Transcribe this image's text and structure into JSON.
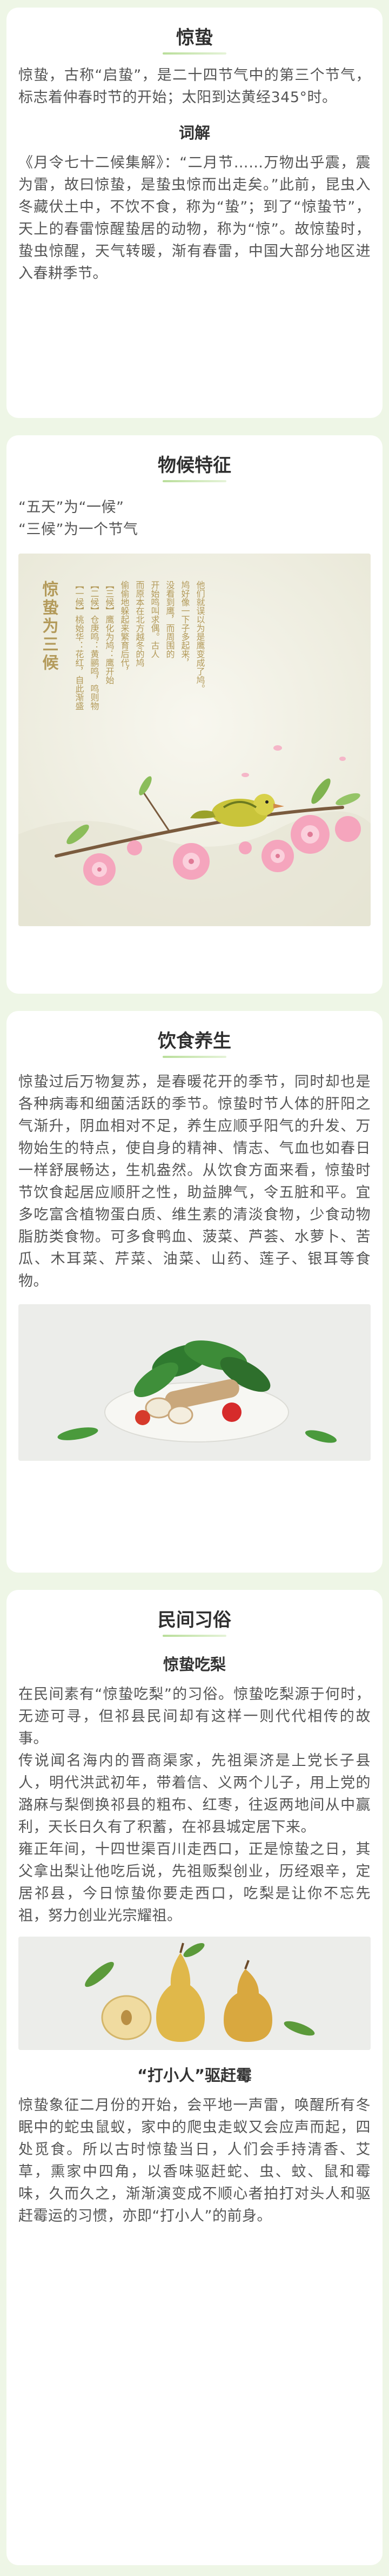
{
  "sections": {
    "jingzhe": {
      "title": "惊蛰",
      "para1": "惊蛰，古称“启蛰”，是二十四节气中的第三个节气，标志着仲春时节的开始；太阳到达黄经345°时。",
      "sub": "词解",
      "para2": "《月令七十二候集解》：“二月节……万物出乎震，震为雷，故曰惊蛰，是蛰虫惊而出走矣。”此前，昆虫入冬藏伏土中，不饮不食，称为“蛰”；到了“惊蛰节”，天上的春雷惊醒蛰居的动物，称为“惊”。故惊蛰时，蛰虫惊醒，天气转暖，渐有春雷，中国大部分地区进入春耕季节。"
    },
    "climate": {
      "title": "物候特征",
      "line1": "“五天”为“一候”",
      "line2": "“三候”为一个节气",
      "art_title": "惊蛰为三候",
      "art_col1": "【一候】桃始华：花红，自此渐盛",
      "art_col2": "【二候】仓庚鸣：黄鹂鸣，鸣则物",
      "art_col3": "【三候】鹰化为鸠：鹰开始",
      "art_col4": "偷偷地躲起来繁育后代，",
      "art_col5": "而原本在北方越冬的鸠",
      "art_col6": "开始鸣叫求偶。古人",
      "art_col7": "没看到鹰，而周围的",
      "art_col8": "鸠好像一下子多起来，",
      "art_col9": "他们就误以为是鹰变成了鸠。"
    },
    "diet": {
      "title": "饮食养生",
      "para": "惊蛰过后万物复苏，是春暖花开的季节，同时却也是各种病毒和细菌活跃的季节。惊蛰时节人体的肝阳之气渐升，阴血相对不足，养生应顺乎阳气的升发、万物始生的特点，使自身的精神、情志、气血也如春日一样舒展畅达，生机盎然。从饮食方面来看，惊蛰时节饮食起居应顺肝之性，助益脾气，令五脏和平。宜多吃富含植物蛋白质、维生素的清淡食物，少食动物脂肪类食物。可多食鸭血、菠菜、芦荟、水萝卜、苦瓜、木耳菜、芹菜、油菜、山药、莲子、银耳等食物。"
    },
    "custom": {
      "title": "民间习俗",
      "sub1": "惊蛰吃梨",
      "para1": "在民间素有“惊蛰吃梨”的习俗。惊蛰吃梨源于何时，无迹可寻，但祁县民间却有这样一则代代相传的故事。",
      "para2": "传说闻名海内的晋商渠家，先祖渠济是上党长子县人，明代洪武初年，带着信、义两个儿子，用上党的潞麻与梨倒换祁县的粗布、红枣，往返两地间从中赢利，天长日久有了积蓄，在祁县城定居下来。",
      "para3": "雍正年间，十四世渠百川走西口，正是惊蛰之日，其父拿出梨让他吃后说，先祖贩梨创业，历经艰辛，定居祁县，今日惊蛰你要走西口，吃梨是让你不忘先祖，努力创业光宗耀祖。",
      "sub2": "“打小人”驱赶霉",
      "para4": "惊蛰象征二月份的开始，会平地一声雷，唤醒所有冬眠中的蛇虫鼠蚁，家中的爬虫走蚁又会应声而起，四处觅食。所以古时惊蛰当日，人们会手持清香、艾草，熏家中四角，以香味驱赶蛇、虫、蚊、鼠和霉味，久而久之，渐渐演变成不顺心者拍打对头人和驱赶霉运的习惯，亦即“打小人”的前身。"
    }
  },
  "colors": {
    "background": "#eef6e6",
    "card": "#ffffff",
    "accent_green": "#b9de9a",
    "text": "#555555"
  }
}
